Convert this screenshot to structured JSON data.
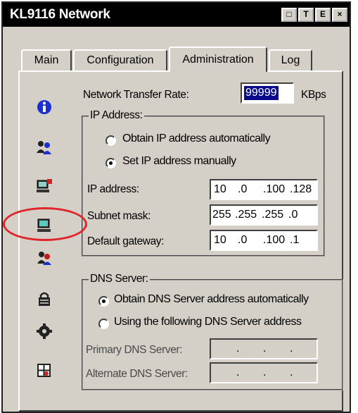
{
  "window": {
    "title": "KL9116 Network",
    "buttons": [
      "restore",
      "help",
      "exit",
      "close"
    ],
    "button_glyphs": [
      "□",
      "T",
      "E",
      "×"
    ]
  },
  "tabs": [
    {
      "label": "Main",
      "active": false
    },
    {
      "label": "Configuration",
      "active": false
    },
    {
      "label": "Administration",
      "active": true
    },
    {
      "label": "Log",
      "active": false
    }
  ],
  "sidebar": {
    "icons": [
      "info-icon",
      "users-icon",
      "computer-red-icon",
      "network-computer-icon",
      "user-admin-icon",
      "lock-icon",
      "gear-icon",
      "device-icon"
    ],
    "highlighted": "network-computer-icon",
    "highlight_color": "#e0242a"
  },
  "network": {
    "transfer_rate_label": "Network Transfer Rate:",
    "transfer_rate_value": "99999",
    "transfer_rate_unit": "KBps"
  },
  "ip_group": {
    "title": "IP Address:",
    "radio_auto": "Obtain IP address automatically",
    "radio_manual": "Set IP address manually",
    "selected": "manual",
    "ip_label": "IP address:",
    "ip_value": [
      "10",
      ".0",
      ".100",
      ".128"
    ],
    "subnet_label": "Subnet mask:",
    "subnet_value": [
      "255",
      ".255",
      ".255",
      ".0"
    ],
    "gateway_label": "Default gateway:",
    "gateway_value": [
      "10",
      ".0",
      ".100",
      ".1"
    ]
  },
  "dns_group": {
    "title": "DNS Server:",
    "radio_auto": "Obtain DNS Server address automatically",
    "radio_manual": "Using the following DNS Server address",
    "selected": "auto",
    "primary_label": "Primary DNS Server:",
    "primary_value": [
      "",
      ".",
      ".",
      "."
    ],
    "alternate_label": "Alternate DNS Server:",
    "alternate_value": [
      "",
      ".",
      ".",
      "."
    ]
  }
}
